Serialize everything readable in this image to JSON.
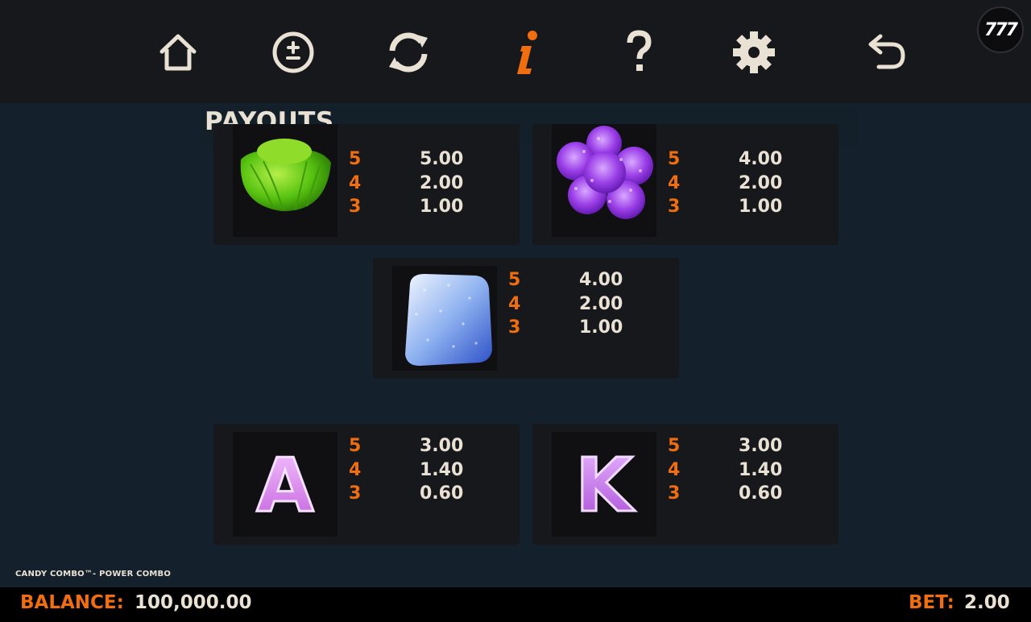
{
  "nav": {
    "items": [
      {
        "name": "home-icon"
      },
      {
        "name": "plus-minus-icon"
      },
      {
        "name": "refresh-icon"
      },
      {
        "name": "info-icon"
      },
      {
        "name": "help-icon"
      },
      {
        "name": "gear-icon"
      },
      {
        "name": "back-arrow-icon"
      }
    ],
    "active": "info-icon",
    "accent_color": "#f06d10",
    "icon_color": "#e9e1d4"
  },
  "logo": {
    "text": "777"
  },
  "page": {
    "title": "PAYOUTS"
  },
  "symbols": [
    {
      "icon": "green-candy-icon",
      "payouts": [
        {
          "count": "5",
          "value": "5.00"
        },
        {
          "count": "4",
          "value": "2.00"
        },
        {
          "count": "3",
          "value": "1.00"
        }
      ]
    },
    {
      "icon": "purple-flower-candy-icon",
      "payouts": [
        {
          "count": "5",
          "value": "4.00"
        },
        {
          "count": "4",
          "value": "2.00"
        },
        {
          "count": "3",
          "value": "1.00"
        }
      ]
    },
    {
      "icon": "blue-sugar-cube-icon",
      "payouts": [
        {
          "count": "5",
          "value": "4.00"
        },
        {
          "count": "4",
          "value": "2.00"
        },
        {
          "count": "3",
          "value": "1.00"
        }
      ]
    },
    {
      "icon": "letter-a-candy-icon",
      "letter": "A",
      "payouts": [
        {
          "count": "5",
          "value": "3.00"
        },
        {
          "count": "4",
          "value": "1.40"
        },
        {
          "count": "3",
          "value": "0.60"
        }
      ]
    },
    {
      "icon": "letter-k-candy-icon",
      "letter": "K",
      "payouts": [
        {
          "count": "5",
          "value": "3.00"
        },
        {
          "count": "4",
          "value": "1.40"
        },
        {
          "count": "3",
          "value": "0.60"
        }
      ]
    }
  ],
  "footer": {
    "game_name": "CANDY COMBO™- POWER COMBO",
    "balance_label": "BALANCE:",
    "balance_value": "100,000.00",
    "bet_label": "BET:",
    "bet_value": "2.00"
  }
}
